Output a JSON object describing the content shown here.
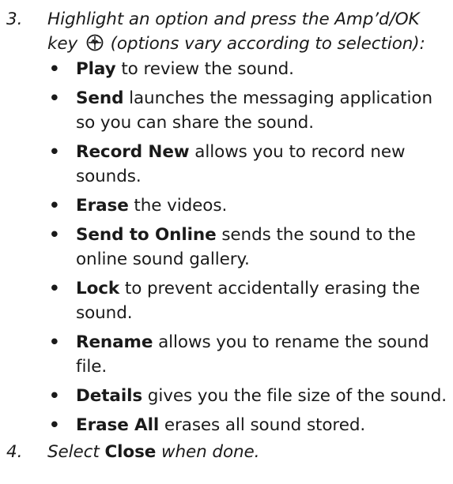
{
  "step3": {
    "number": "3.",
    "text_before_icon": "Highlight an option and press the Amp’d/OK key",
    "icon": "amp-ok-key-icon",
    "text_after_icon": "(options vary according to selection):"
  },
  "options": [
    {
      "term": "Play",
      "desc": " to review the sound."
    },
    {
      "term": "Send",
      "desc": " launches the messaging application so you can share the sound."
    },
    {
      "term": "Record New",
      "desc": " allows you to record new sounds."
    },
    {
      "term": "Erase",
      "desc": " the videos."
    },
    {
      "term": "Send to Online",
      "desc": " sends the sound to the online sound gallery."
    },
    {
      "term": "Lock",
      "desc": " to prevent accidentally erasing the sound."
    },
    {
      "term": "Rename",
      "desc": " allows you to rename the sound file."
    },
    {
      "term": "Details",
      "desc": " gives you the file size of the sound."
    },
    {
      "term": "Erase All",
      "desc": " erases all sound stored."
    }
  ],
  "bullet_char": "•",
  "step4": {
    "number": "4.",
    "prefix": "Select ",
    "bold": "Close",
    "suffix": " when done."
  }
}
